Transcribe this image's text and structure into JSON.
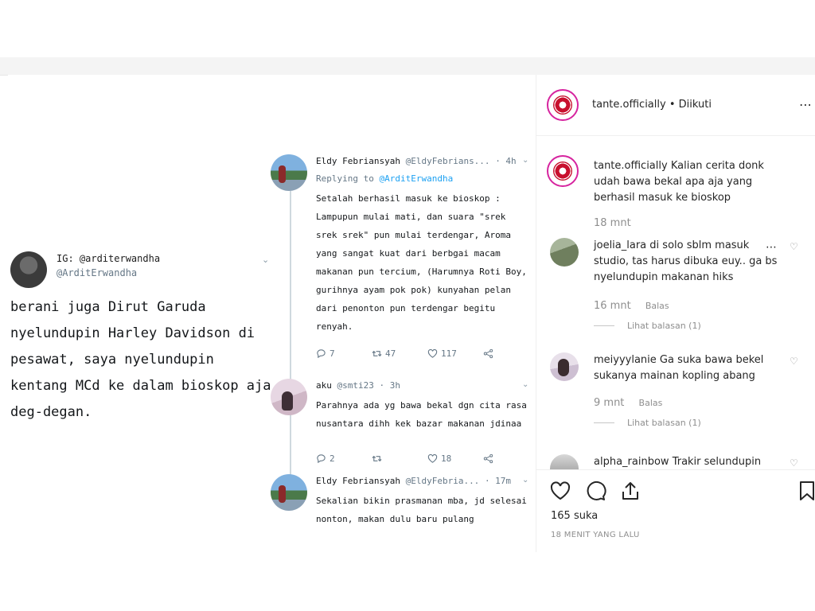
{
  "main_tweet": {
    "name": "IG: @arditerwandha",
    "handle": "@ArditErwandha",
    "text": "berani juga Dirut Garuda nyelundupin Harley Davidson di pesawat, saya nyelundupin kentang MCd ke dalam bioskop aja deg-degan."
  },
  "replies": [
    {
      "name": "Eldy Febriansyah",
      "handle": "@EldyFebrians...",
      "time": "· 4h",
      "replying_label": "Replying to",
      "replying_to": "@ArditErwandha",
      "text": "Setalah berhasil masuk ke bioskop : Lampupun mulai mati, dan suara \"srek srek srek\" pun mulai terdengar, Aroma yang sangat kuat dari berbgai macam makanan pun tercium, (Harumnya Roti Boy, gurihnya ayam pok pok) kunyahan pelan dari penonton pun terdengar begitu renyah.",
      "replies": "7",
      "retweets": "47",
      "likes": "117"
    },
    {
      "name": "aku",
      "handle": "@smti23",
      "time": "· 3h",
      "text": "Parahnya ada yg bawa bekal dgn cita rasa nusantara dihh kek bazar makanan jdinaa",
      "replies": "2",
      "retweets": "",
      "likes": "18"
    },
    {
      "name": "Eldy Febriansyah",
      "handle": "@EldyFebria...",
      "time": "· 17m",
      "text": "Sekalian bikin prasmanan mba, jd selesai nonton, makan dulu baru pulang"
    }
  ],
  "instagram": {
    "header_user": "tante.officially",
    "header_follow": "• Diikuti",
    "caption_user": "tante.officially",
    "caption_text": "Kalian cerita donk udah bawa bekal apa aja yang berhasil masuk ke bioskop",
    "caption_time": "18 mnt",
    "comments": [
      {
        "user": "joelia_lara",
        "text": "di solo sblm masuk studio, tas harus dibuka euy.. ga bs nyelundupin makanan hiks",
        "time": "16 mnt",
        "reply_label": "Balas",
        "view_replies": "Lihat balasan (1)"
      },
      {
        "user": "meiyyylanie",
        "text": "Ga suka bawa bekel sukanya mainan kopling abang",
        "time": "9 mnt",
        "reply_label": "Balas",
        "view_replies": "Lihat balasan (1)"
      },
      {
        "user": "alpha_rainbow",
        "text": "Trakir selundupin"
      }
    ],
    "likes": "165 suka",
    "posted": "18 MENIT YANG LALU"
  },
  "icons": {
    "reply": "reply-icon",
    "retweet": "retweet-icon",
    "like": "heart-icon",
    "share": "share-icon",
    "ig_like": "heart-icon",
    "ig_comment": "comment-icon",
    "ig_share": "share-icon",
    "ig_save": "bookmark-icon"
  },
  "colors": {
    "twitter_blue": "#1da1f2",
    "ig_ring": "#d6249f",
    "muted": "#8e8e8e"
  }
}
